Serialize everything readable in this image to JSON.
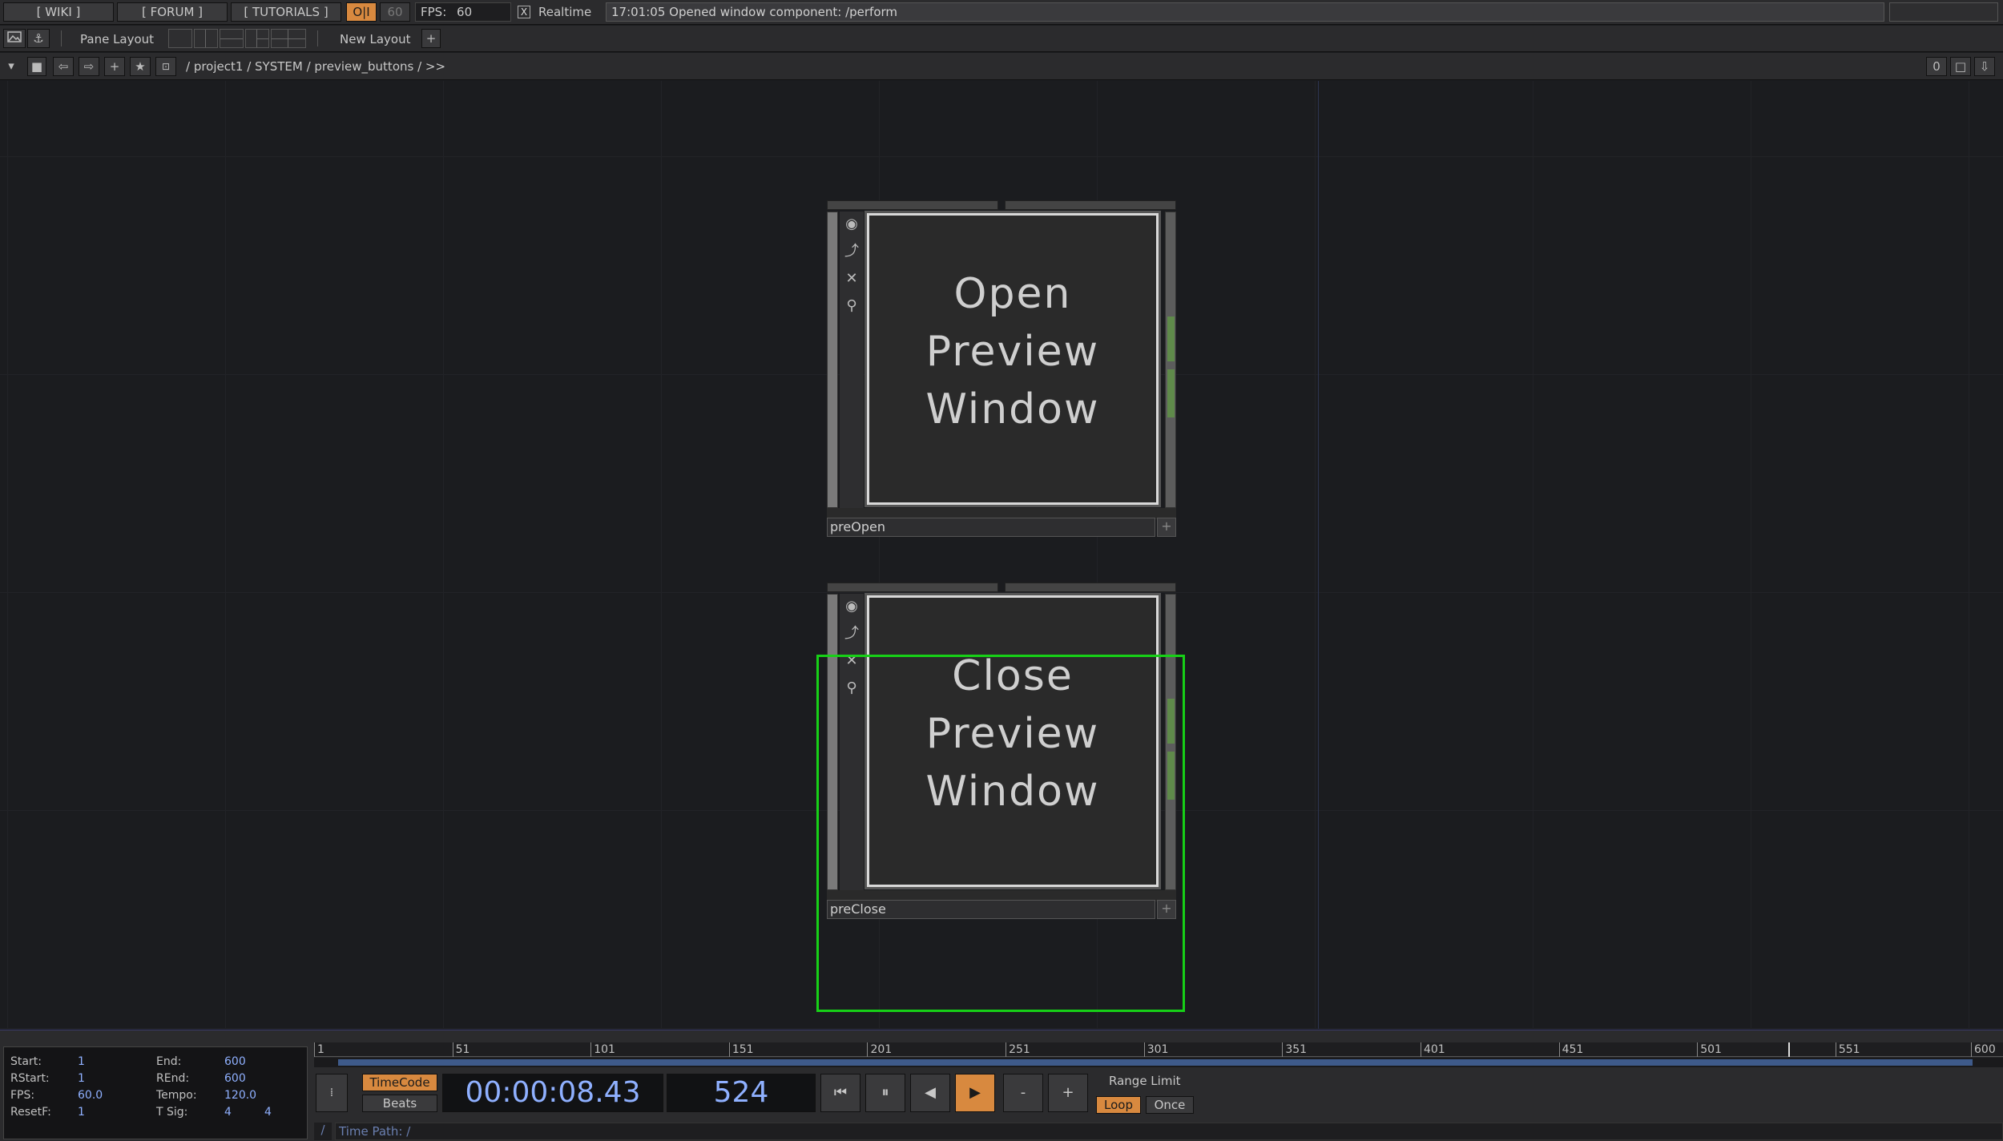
{
  "topbar": {
    "wiki": "[ WIKI ]",
    "forum": "[ FORUM ]",
    "tutorials": "[ TUTORIALS ]",
    "oi": "O|I",
    "fps_small": "60",
    "fps_label": "FPS:",
    "fps_value": "60",
    "realtime_label": "Realtime",
    "realtime_checked": "X",
    "log_message": "17:01:05 Opened window component: /perform"
  },
  "layoutbar": {
    "pane_layout": "Pane Layout",
    "new_layout": "New Layout",
    "add": "+"
  },
  "pathbar": {
    "path": "/ project1 / SYSTEM / preview_buttons / >>",
    "counter": "0"
  },
  "nodes": [
    {
      "name": "preOpen",
      "view_lines": [
        "Open",
        "Preview",
        "Window"
      ]
    },
    {
      "name": "preClose",
      "view_lines": [
        "Close",
        "Preview",
        "Window"
      ]
    }
  ],
  "timeline": {
    "info": {
      "start_label": "Start:",
      "start": "1",
      "end_label": "End:",
      "end": "600",
      "rstart_label": "RStart:",
      "rstart": "1",
      "rend_label": "REnd:",
      "rend": "600",
      "fps_label": "FPS:",
      "fps": "60.0",
      "tempo_label": "Tempo:",
      "tempo": "120.0",
      "resetf_label": "ResetF:",
      "resetf": "1",
      "tsig_label": "T Sig:",
      "tsig_a": "4",
      "tsig_b": "4"
    },
    "ruler_ticks": [
      "1",
      "51",
      "101",
      "151",
      "201",
      "251",
      "301",
      "351",
      "401",
      "451",
      "501",
      "551",
      "600"
    ],
    "timecode_label": "TimeCode",
    "beats_label": "Beats",
    "timecode": "00:00:08.43",
    "frame": "524",
    "minus": "-",
    "plus": "+",
    "range_limit": "Range Limit",
    "loop": "Loop",
    "once": "Once",
    "time_path": "Time Path: /"
  }
}
